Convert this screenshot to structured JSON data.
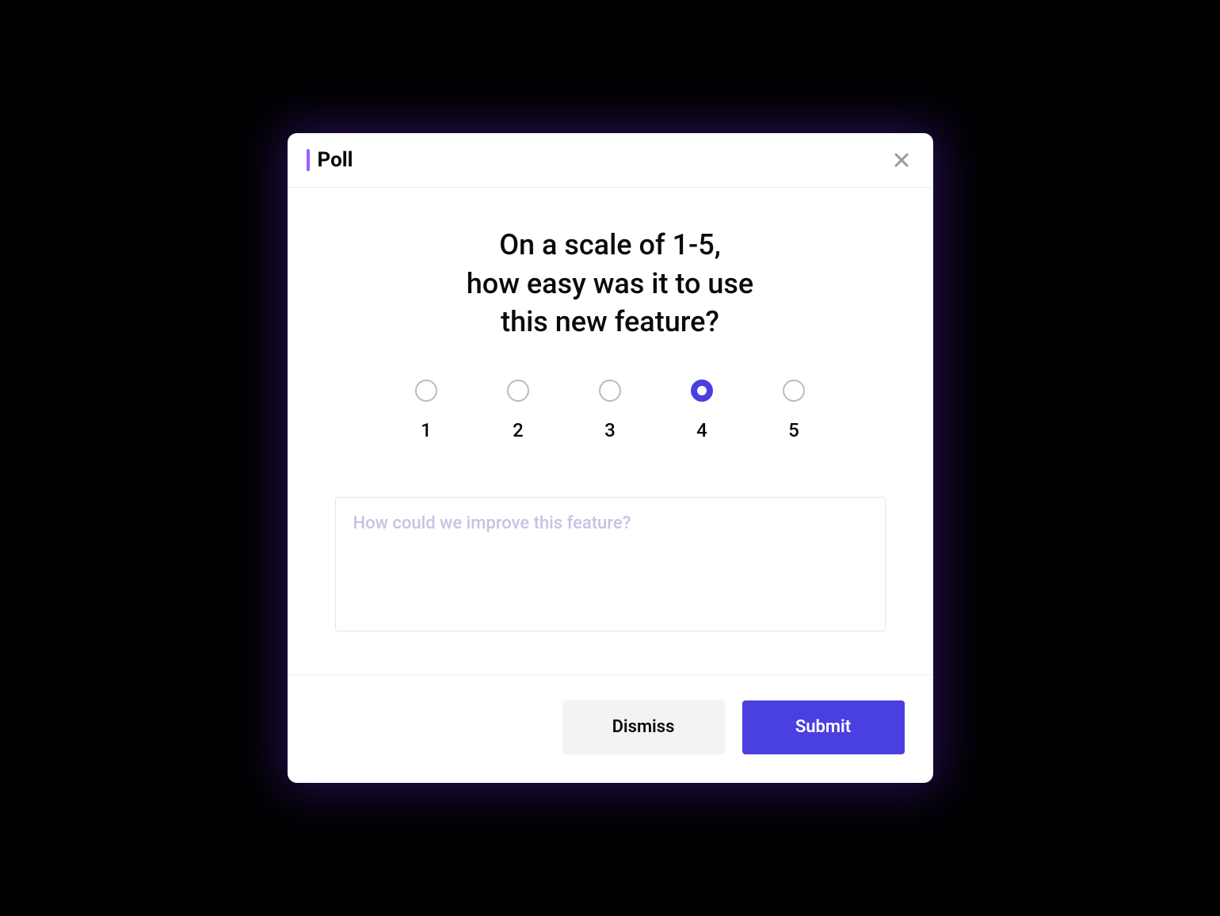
{
  "header": {
    "title": "Poll"
  },
  "question": "On a scale of 1-5,\nhow easy was it to use\nthis new feature?",
  "scale": {
    "options": [
      "1",
      "2",
      "3",
      "4",
      "5"
    ],
    "selected": "4"
  },
  "feedback": {
    "placeholder": "How could we improve this feature?",
    "value": ""
  },
  "footer": {
    "dismiss_label": "Dismiss",
    "submit_label": "Submit"
  },
  "colors": {
    "accent": "#4a3fe0",
    "title_bar": "#a259ff"
  }
}
